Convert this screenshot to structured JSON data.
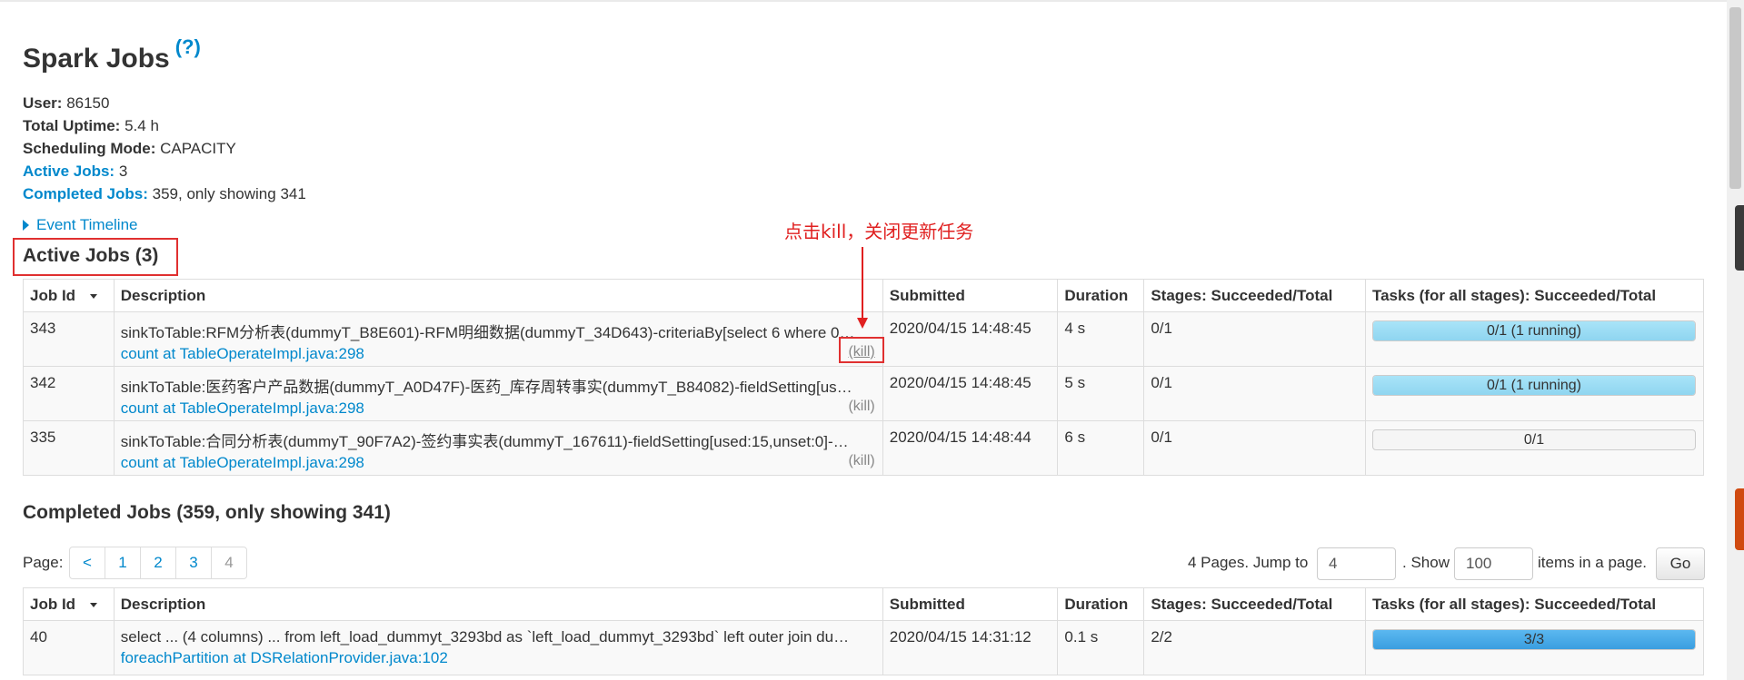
{
  "page": {
    "title": "Spark Jobs",
    "help": "(?)"
  },
  "summary": {
    "user_label": "User:",
    "user_value": " 86150",
    "uptime_label": "Total Uptime:",
    "uptime_value": " 5.4 h",
    "sched_label": "Scheduling Mode:",
    "sched_value": " CAPACITY",
    "active_label": "Active Jobs:",
    "active_value": " 3",
    "completed_label": "Completed Jobs:",
    "completed_value": " 359, only showing 341"
  },
  "event_timeline": "Event Timeline",
  "annotation": "点击kill，关闭更新任务",
  "active_section": {
    "title": "Active Jobs (3)",
    "columns": [
      "Job Id",
      "Description",
      "Submitted",
      "Duration",
      "Stages: Succeeded/Total",
      "Tasks (for all stages): Succeeded/Total"
    ],
    "rows": [
      {
        "id": "343",
        "desc": "sinkToTable:RFM分析表(dummyT_B8E601)-RFM明细数据(dummyT_34D643)-criteriaBy[select 6 where 0…",
        "callsite": "count at TableOperateImpl.java:298",
        "kill": "(kill)",
        "submitted": "2020/04/15 14:48:45",
        "duration": "4 s",
        "stages": "0/1",
        "tasks_text": "0/1 (1 running)",
        "tasks_fraction": 0,
        "tasks_running_fraction": 1
      },
      {
        "id": "342",
        "desc": "sinkToTable:医药客户产品数据(dummyT_A0D47F)-医药_库存周转事实(dummyT_B84082)-fieldSetting[us…",
        "callsite": "count at TableOperateImpl.java:298",
        "kill": "(kill)",
        "submitted": "2020/04/15 14:48:45",
        "duration": "5 s",
        "stages": "0/1",
        "tasks_text": "0/1 (1 running)",
        "tasks_fraction": 0,
        "tasks_running_fraction": 1
      },
      {
        "id": "335",
        "desc": "sinkToTable:合同分析表(dummyT_90F7A2)-签约事实表(dummyT_167611)-fieldSetting[used:15,unset:0]-…",
        "callsite": "count at TableOperateImpl.java:298",
        "kill": "(kill)",
        "submitted": "2020/04/15 14:48:44",
        "duration": "6 s",
        "stages": "0/1",
        "tasks_text": "0/1",
        "tasks_fraction": 0,
        "tasks_running_fraction": 0
      }
    ]
  },
  "completed_section": {
    "title": "Completed Jobs (359, only showing 341)",
    "page_label": "Page:",
    "pages": [
      "<",
      "1",
      "2",
      "3",
      "4"
    ],
    "pages_info": "4 Pages. Jump to",
    "jump_value": "4",
    "show_label": ". Show",
    "show_value": "100",
    "items_label": "items in a page.",
    "go_label": "Go",
    "columns": [
      "Job Id",
      "Description",
      "Submitted",
      "Duration",
      "Stages: Succeeded/Total",
      "Tasks (for all stages): Succeeded/Total"
    ],
    "rows": [
      {
        "id": "40",
        "desc": "select ... (4 columns) ... from left_load_dummyt_3293bd as `left_load_dummyt_3293bd` left outer join du…",
        "callsite": "foreachPartition at DSRelationProvider.java:102",
        "submitted": "2020/04/15 14:31:12",
        "duration": "0.1 s",
        "stages": "2/2",
        "tasks_text": "3/3",
        "tasks_fraction": 1
      }
    ]
  },
  "colors": {
    "link": "#0088cc",
    "annotation": "#e02020",
    "running_bar": "#a0dff5",
    "completed_bar": "#3a9ee0"
  }
}
